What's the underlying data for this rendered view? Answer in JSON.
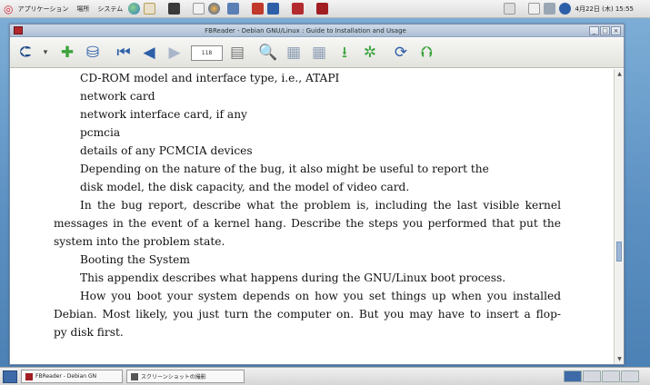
{
  "top_panel": {
    "applications": "アプリケーション",
    "places": "場所",
    "system": "システム",
    "clock": "4月22日 (木) 15:55"
  },
  "window": {
    "title": "FBReader - Debian GNU/Linux : Guide to Installation and Usage",
    "minimize": "_",
    "maximize": "□",
    "close": "×"
  },
  "toolbar": {
    "page_number": "118"
  },
  "content": {
    "lines": [
      "CD-ROM model and interface type, i.e., ATAPI",
      "network card",
      "network interface card, if any",
      "pcmcia",
      "details of any PCMCIA devices",
      "Depending on the nature of the bug, it also might be useful to report the",
      "disk model, the disk capacity, and the model of video card.",
      "In the bug report, describe what the problem is, including the last visible kernel",
      "messages in the event of a kernel hang. Describe the steps you performed that put the",
      "system into the problem state.",
      "Booting the System",
      "This appendix describes what happens during the GNU/Linux boot process.",
      "How you boot your system depends on how you set things up when you installed",
      "Debian. Most likely, you just turn the computer on. But you may have to insert a flop-",
      "py disk first."
    ]
  },
  "taskbar": {
    "task_fbreader": "FBReader - Debian GN",
    "task_screenshot": "スクリーンショットの撮影"
  },
  "colors": {
    "selection_accent": "#3e6aa8",
    "toolbar_green": "#3aa33a",
    "toolbar_blue": "#2c5fa8"
  }
}
